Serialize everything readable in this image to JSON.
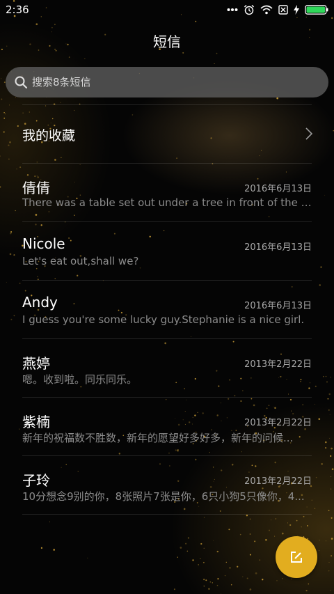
{
  "status_bar": {
    "time": "2:36",
    "icons": [
      "more-dots-icon",
      "alarm-icon",
      "wifi-icon",
      "no-sim-icon",
      "charging-icon",
      "battery-icon"
    ]
  },
  "header": {
    "title": "短信"
  },
  "search": {
    "placeholder": "搜索8条短信"
  },
  "favorites": {
    "label": "我的收藏"
  },
  "messages": [
    {
      "name": "倩倩",
      "date": "2016年6月13日",
      "preview": "There was a table set out under a tree in front of the ho..."
    },
    {
      "name": "Nicole",
      "date": "2016年6月13日",
      "preview": "Let's eat out,shall we?"
    },
    {
      "name": "Andy",
      "date": "2016年6月13日",
      "preview": "I guess you're some lucky guy.Stephanie is a nice girl."
    },
    {
      "name": "燕婷",
      "date": "2013年2月22日",
      "preview": "嗯。收到啦。同乐同乐。"
    },
    {
      "name": "紫楠",
      "date": "2013年2月22日",
      "preview": "新年的祝福数不胜数，新年的愿望好多好多，新年的问候..."
    },
    {
      "name": "子玲",
      "date": "2013年2月22日",
      "preview": "10分想念9别的你，8张照片7张是你，6只小狗5只像你，4..."
    }
  ],
  "fab": {
    "icon": "compose-icon"
  },
  "colors": {
    "accent": "#e2ad1f",
    "background": "#000000",
    "search_bg": "#5f5f5f"
  }
}
